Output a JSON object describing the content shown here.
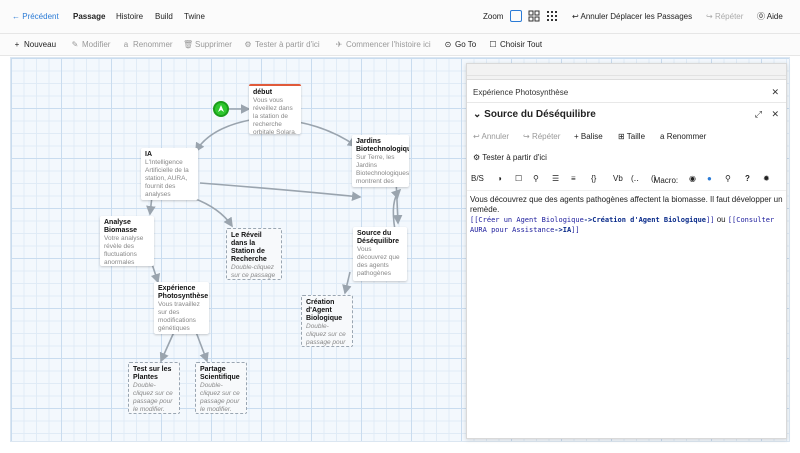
{
  "nav": {
    "back": "Précédent",
    "tabs": [
      "Passage",
      "Histoire",
      "Build",
      "Twine"
    ],
    "zoom_label": "Zoom",
    "undo": "Annuler Déplacer les Passages",
    "redo": "Répéter",
    "help": "Aide"
  },
  "toolbar": {
    "new": "Nouveau",
    "edit": "Modifier",
    "rename": "Renommer",
    "delete": "Supprimer",
    "test_from_here": "Tester à partir d'ici",
    "start_story_here": "Commencer l'histoire ici",
    "go_to": "Go To",
    "select_all": "Choisir Tout"
  },
  "passages": [
    {
      "title": "début",
      "excerpt": "Vous vous réveillez dans la station de recherche orbitale Solara,"
    },
    {
      "title": "IA",
      "excerpt": "L'Intelligence Artificielle de la station, AURA, fournit des analyses"
    },
    {
      "title": "Jardins Biotechnologiques",
      "excerpt": "Sur Terre, les Jardins Biotechnologiques montrent des"
    },
    {
      "title": "Analyse Biomasse",
      "excerpt": "Votre analyse révèle des fluctuations anormales"
    },
    {
      "title": "Le Réveil dans la Station de Recherche",
      "excerpt": "Double-cliquez sur ce passage pour le"
    },
    {
      "title": "Source du Déséquilibre",
      "excerpt": "Vous découvrez que des agents pathogènes"
    },
    {
      "title": "Expérience Photosynthèse",
      "excerpt": "Vous travaillez sur des modifications génétiques"
    },
    {
      "title": "Création d'Agent Biologique",
      "excerpt": "Double-cliquez sur ce passage pour le"
    },
    {
      "title": "Test sur les Plantes",
      "excerpt": "Double-cliquez sur ce passage pour le modifier."
    },
    {
      "title": "Partage Scientifique",
      "excerpt": "Double-cliquez sur ce passage pour le modifier."
    }
  ],
  "dialog": {
    "stack_title": "Expérience Photosynthèse",
    "title": "Source du Déséquilibre",
    "actions": {
      "undo": "Annuler",
      "redo": "Répéter",
      "tag": "Balise",
      "size": "Taille",
      "rename": "Renommer",
      "test_from_here": "Tester à partir d'ici"
    },
    "format_toolbar": [
      "B/S",
      "{}",
      "Vb",
      "Macro:"
    ],
    "body_text": "Vous découvrez que des agents pathogènes affectent la biomasse. Il faut développer un remède.",
    "link1_open": "[[Créer un Agent Biologique",
    "link1_target": "Création d'Agent Biologique",
    "link1_close": "]]",
    "or_text": " ou ",
    "link2_open": "[[Consulter AURA pour Assistance",
    "link2_target": "IA",
    "link2_close": "]]",
    "arrow": "->"
  },
  "colors": {
    "accent": "#2b7bd6",
    "start": "#e05a3a",
    "rocket": "#2ec72e"
  }
}
